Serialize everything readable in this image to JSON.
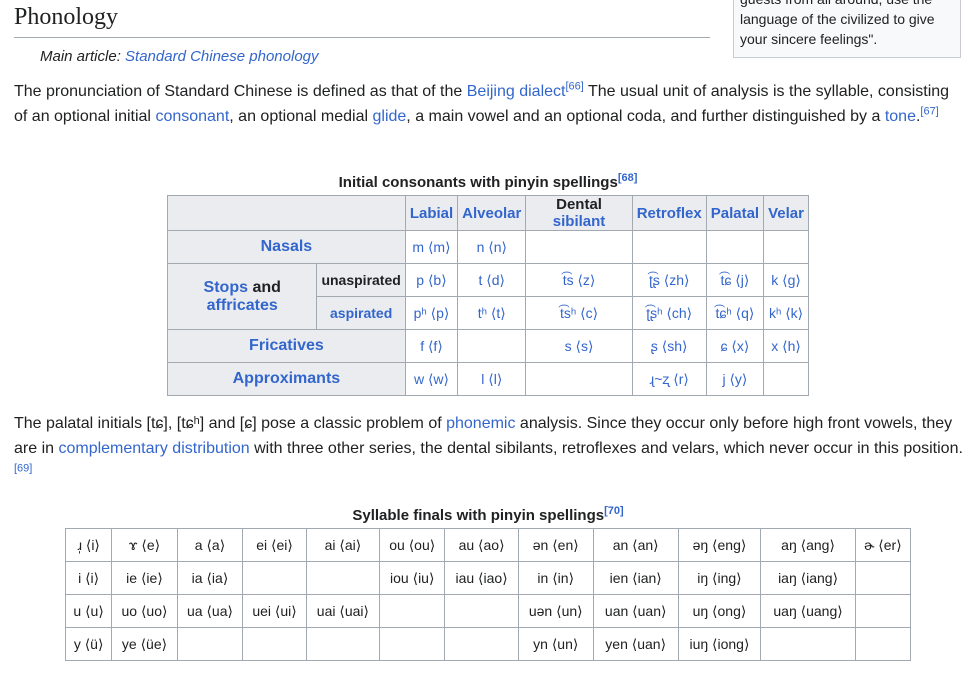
{
  "quote_box": {
    "line1": "guests from all around, use the",
    "line2": "language of the civilized to give",
    "line3": "your sincere feelings\"."
  },
  "section": {
    "title": "Phonology",
    "hatnote_prefix": "Main article: ",
    "hatnote_link": "Standard Chinese phonology"
  },
  "para1": {
    "t1": "The pronunciation of Standard Chinese is defined as that of the ",
    "link_beijing": "Beijing dialect",
    "ref1": "[66]",
    "t2": " The usual unit of analysis is the syllable, consisting of an optional initial ",
    "link_consonant": "consonant",
    "t3": ", an optional medial ",
    "link_glide": "glide",
    "t4": ", a main vowel and an optional coda, and further distinguished by a ",
    "link_tone": "tone",
    "t5": ".",
    "ref2": "[67]"
  },
  "cons_table": {
    "caption": "Initial consonants with pinyin spellings",
    "caption_ref": "[68]",
    "headers": [
      "Labial",
      "Alveolar",
      "Dental",
      "sibilant",
      "Retroflex",
      "Palatal",
      "Velar"
    ],
    "rows": {
      "nasals": "Nasals",
      "stops": "Stops",
      "and": " and ",
      "affricates": "affricates",
      "unaspirated": "unaspirated",
      "aspirated": "aspirated",
      "fricatives": "Fricatives",
      "approximants": "Approximants"
    },
    "cells": {
      "nasal_labial": "m ⟨m⟩",
      "nasal_alveolar": "n ⟨n⟩",
      "unasp_labial": "p ⟨b⟩",
      "unasp_alveolar": "t ⟨d⟩",
      "unasp_dental": "t͡s ⟨z⟩",
      "unasp_retroflex": "ʈ͡ʂ ⟨zh⟩",
      "unasp_palatal": "t͡ɕ ⟨j⟩",
      "unasp_velar": "k ⟨g⟩",
      "asp_labial": "pʰ ⟨p⟩",
      "asp_alveolar": "tʰ ⟨t⟩",
      "asp_dental": "t͡sʰ ⟨c⟩",
      "asp_retroflex": "ʈ͡ʂʰ ⟨ch⟩",
      "asp_palatal": "t͡ɕʰ ⟨q⟩",
      "asp_velar": "kʰ ⟨k⟩",
      "fric_labial": "f ⟨f⟩",
      "fric_dental": "s ⟨s⟩",
      "fric_retroflex": "ʂ ⟨sh⟩",
      "fric_palatal": "ɕ ⟨x⟩",
      "fric_velar": "x ⟨h⟩",
      "appr_labial": "w ⟨w⟩",
      "appr_alveolar": "l ⟨l⟩",
      "appr_retroflex": "ɻ~ʐ ⟨r⟩",
      "appr_palatal": "j ⟨y⟩"
    }
  },
  "para2": {
    "t1": "The palatal initials [tɕ], [tɕʰ] and [ɕ] pose a classic problem of ",
    "link_phonemic": "phonemic",
    "t2": " analysis. Since they occur only before high front vowels, they are in ",
    "link_complementary": "complementary distribution",
    "t3": " with three other series, the dental sibilants, retroflexes and velars, which never occur in this position.",
    "ref": "[69]"
  },
  "finals_table": {
    "caption": "Syllable finals with pinyin spellings",
    "caption_ref": "[70]",
    "rows": [
      [
        "ɹ̩ ⟨i⟩",
        "ɤ ⟨e⟩",
        "a ⟨a⟩",
        "ei ⟨ei⟩",
        "ai ⟨ai⟩",
        "ou ⟨ou⟩",
        "au ⟨ao⟩",
        "ən ⟨en⟩",
        "an ⟨an⟩",
        "əŋ ⟨eng⟩",
        "aŋ ⟨ang⟩",
        "ɚ ⟨er⟩"
      ],
      [
        "i ⟨i⟩",
        "ie ⟨ie⟩",
        "ia ⟨ia⟩",
        "",
        "",
        "iou ⟨iu⟩",
        "iau ⟨iao⟩",
        "in ⟨in⟩",
        "ien ⟨ian⟩",
        "iŋ ⟨ing⟩",
        "iaŋ ⟨iang⟩",
        ""
      ],
      [
        "u ⟨u⟩",
        "uo ⟨uo⟩",
        "ua ⟨ua⟩",
        "uei ⟨ui⟩",
        "uai ⟨uai⟩",
        "",
        "",
        "uən ⟨un⟩",
        "uan ⟨uan⟩",
        "uŋ ⟨ong⟩",
        "uaŋ ⟨uang⟩",
        ""
      ],
      [
        "y ⟨ü⟩",
        "ye ⟨üe⟩",
        "",
        "",
        "",
        "",
        "",
        "yn ⟨un⟩",
        "yen ⟨uan⟩",
        "iuŋ ⟨iong⟩",
        "",
        ""
      ]
    ]
  }
}
